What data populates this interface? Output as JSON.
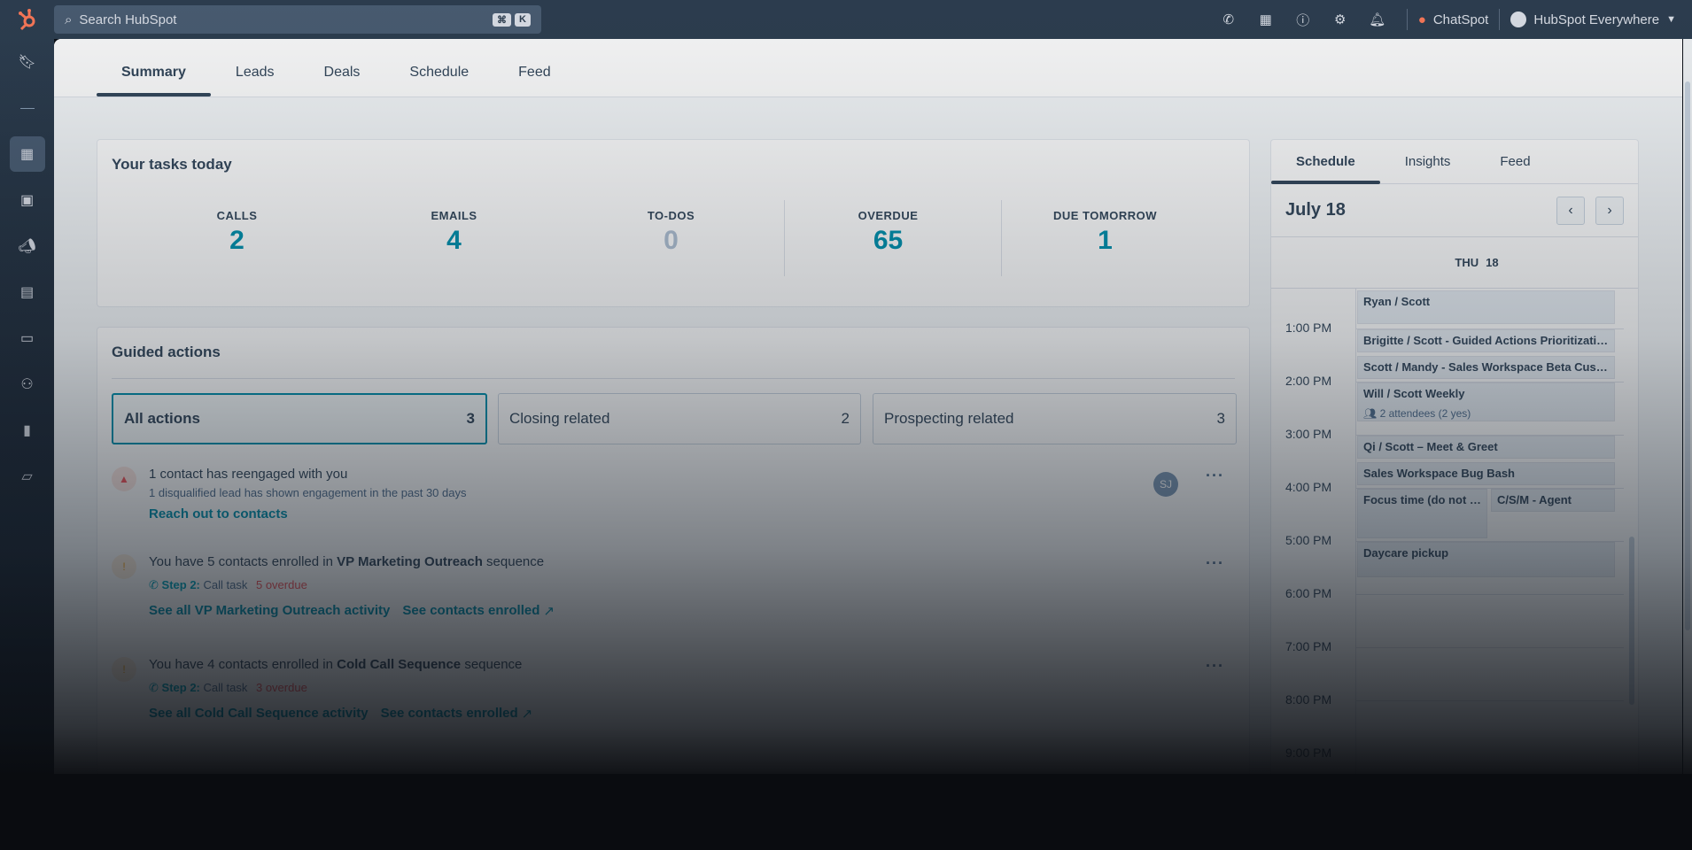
{
  "search": {
    "placeholder": "Search HubSpot",
    "shortcut_keys": [
      "⌘",
      "K"
    ]
  },
  "topbar": {
    "chatspot_label": "ChatSpot",
    "account_label": "HubSpot Everywhere"
  },
  "tabs": [
    {
      "label": "Summary"
    },
    {
      "label": "Leads"
    },
    {
      "label": "Deals"
    },
    {
      "label": "Schedule"
    },
    {
      "label": "Feed"
    }
  ],
  "tasks": {
    "title": "Your tasks today",
    "stats": [
      {
        "label": "CALLS",
        "value": "2"
      },
      {
        "label": "EMAILS",
        "value": "4"
      },
      {
        "label": "TO-DOS",
        "value": "0"
      },
      {
        "label": "OVERDUE",
        "value": "65"
      },
      {
        "label": "DUE TOMORROW",
        "value": "1"
      }
    ]
  },
  "guided": {
    "title": "Guided actions",
    "filters": [
      {
        "label": "All actions",
        "count": "3"
      },
      {
        "label": "Closing related",
        "count": "2"
      },
      {
        "label": "Prospecting related",
        "count": "3"
      }
    ],
    "actions": [
      {
        "title": "1 contact has reengaged with you",
        "sub": "1 disqualified lead has shown engagement in the past 30 days",
        "link": "Reach out to contacts",
        "avatar": "SJ"
      },
      {
        "title_pre": "You have 5 contacts enrolled in ",
        "title_bold": "VP Marketing Outreach",
        "title_post": " sequence",
        "step_label": "Step 2:",
        "step_task": "Call task",
        "overdue": "5 overdue",
        "link1": "See all VP Marketing Outreach activity",
        "link2": "See contacts enrolled"
      },
      {
        "title_pre": "You have 4 contacts enrolled in ",
        "title_bold": "Cold Call Sequence",
        "title_post": " sequence",
        "step_label": "Step 2:",
        "step_task": "Call task",
        "overdue": "3 overdue",
        "link1": "See all Cold Call Sequence activity",
        "link2": "See contacts enrolled"
      }
    ]
  },
  "schedule": {
    "tabs": [
      {
        "label": "Schedule"
      },
      {
        "label": "Insights"
      },
      {
        "label": "Feed"
      }
    ],
    "date": "July 18",
    "day_name": "THU",
    "day_num": "18",
    "times": [
      "1:00 PM",
      "2:00 PM",
      "3:00 PM",
      "4:00 PM",
      "5:00 PM",
      "6:00 PM",
      "7:00 PM",
      "8:00 PM",
      "9:00 PM"
    ],
    "events": [
      {
        "title": "Ryan / Scott"
      },
      {
        "title": "Brigitte / Scott - Guided Actions Prioritization"
      },
      {
        "title": "Scott / Mandy - Sales Workspace Beta Custo..."
      },
      {
        "title": "Will / Scott Weekly",
        "sub": "2 attendees (2 yes)"
      },
      {
        "title": "Qi / Scott – Meet & Greet"
      },
      {
        "title": "Sales Workspace Bug Bash"
      },
      {
        "title": "Focus time (do not bo..."
      },
      {
        "title": "C/S/M - Agent"
      },
      {
        "title": "Daycare pickup"
      }
    ]
  }
}
